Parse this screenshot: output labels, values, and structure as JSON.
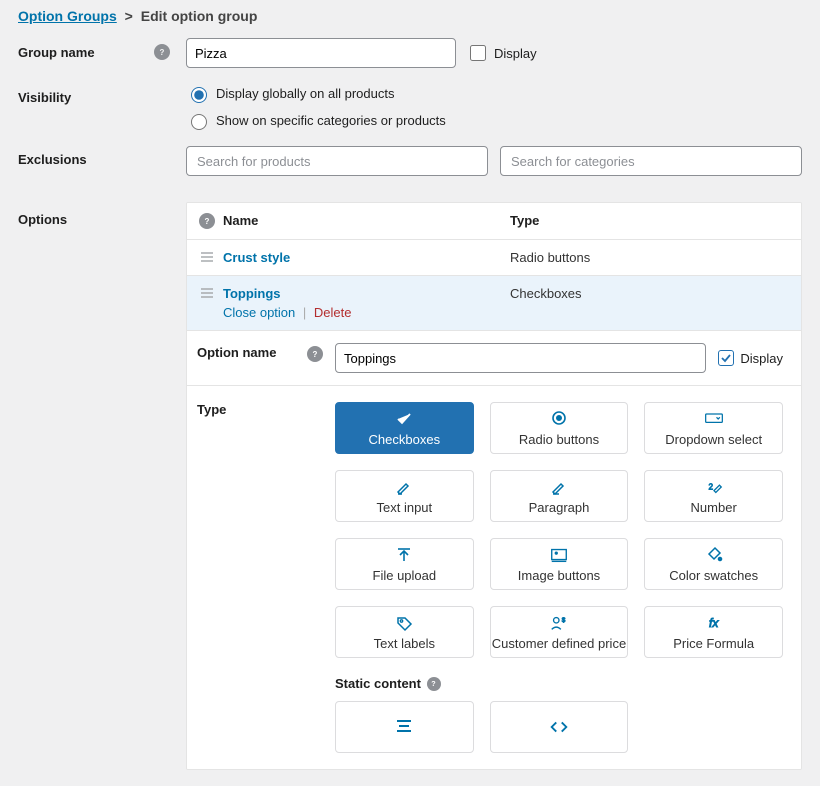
{
  "breadcrumb": {
    "link": "Option Groups",
    "sep": ">",
    "current": "Edit option group"
  },
  "labels": {
    "group_name": "Group name",
    "display_chk": "Display",
    "visibility": "Visibility",
    "exclusions": "Exclusions",
    "options": "Options",
    "option_name": "Option name",
    "display_inner": "Display",
    "type": "Type",
    "static": "Static content"
  },
  "group_name_value": "Pizza",
  "visibility": {
    "opt_all": "Display globally on all products",
    "opt_specific": "Show on specific categories or products"
  },
  "exclusions": {
    "products_ph": "Search for products",
    "categories_ph": "Search for categories"
  },
  "option_table": {
    "head_name": "Name",
    "head_type": "Type",
    "rows": [
      {
        "name": "Crust style",
        "type": "Radio buttons"
      },
      {
        "name": "Toppings",
        "type": "Checkboxes",
        "close": "Close option",
        "delete": "Delete"
      }
    ]
  },
  "option_name_value": "Toppings",
  "type_cards": [
    {
      "id": "checkboxes",
      "label": "Checkboxes"
    },
    {
      "id": "radio",
      "label": "Radio buttons"
    },
    {
      "id": "dropdown",
      "label": "Dropdown select"
    },
    {
      "id": "text",
      "label": "Text input"
    },
    {
      "id": "paragraph",
      "label": "Paragraph"
    },
    {
      "id": "number",
      "label": "Number"
    },
    {
      "id": "file",
      "label": "File upload"
    },
    {
      "id": "imagebtn",
      "label": "Image buttons"
    },
    {
      "id": "swatch",
      "label": "Color swatches"
    },
    {
      "id": "textlabel",
      "label": "Text labels"
    },
    {
      "id": "customerprice",
      "label": "Customer defined price"
    },
    {
      "id": "formula",
      "label": "Price Formula"
    }
  ]
}
